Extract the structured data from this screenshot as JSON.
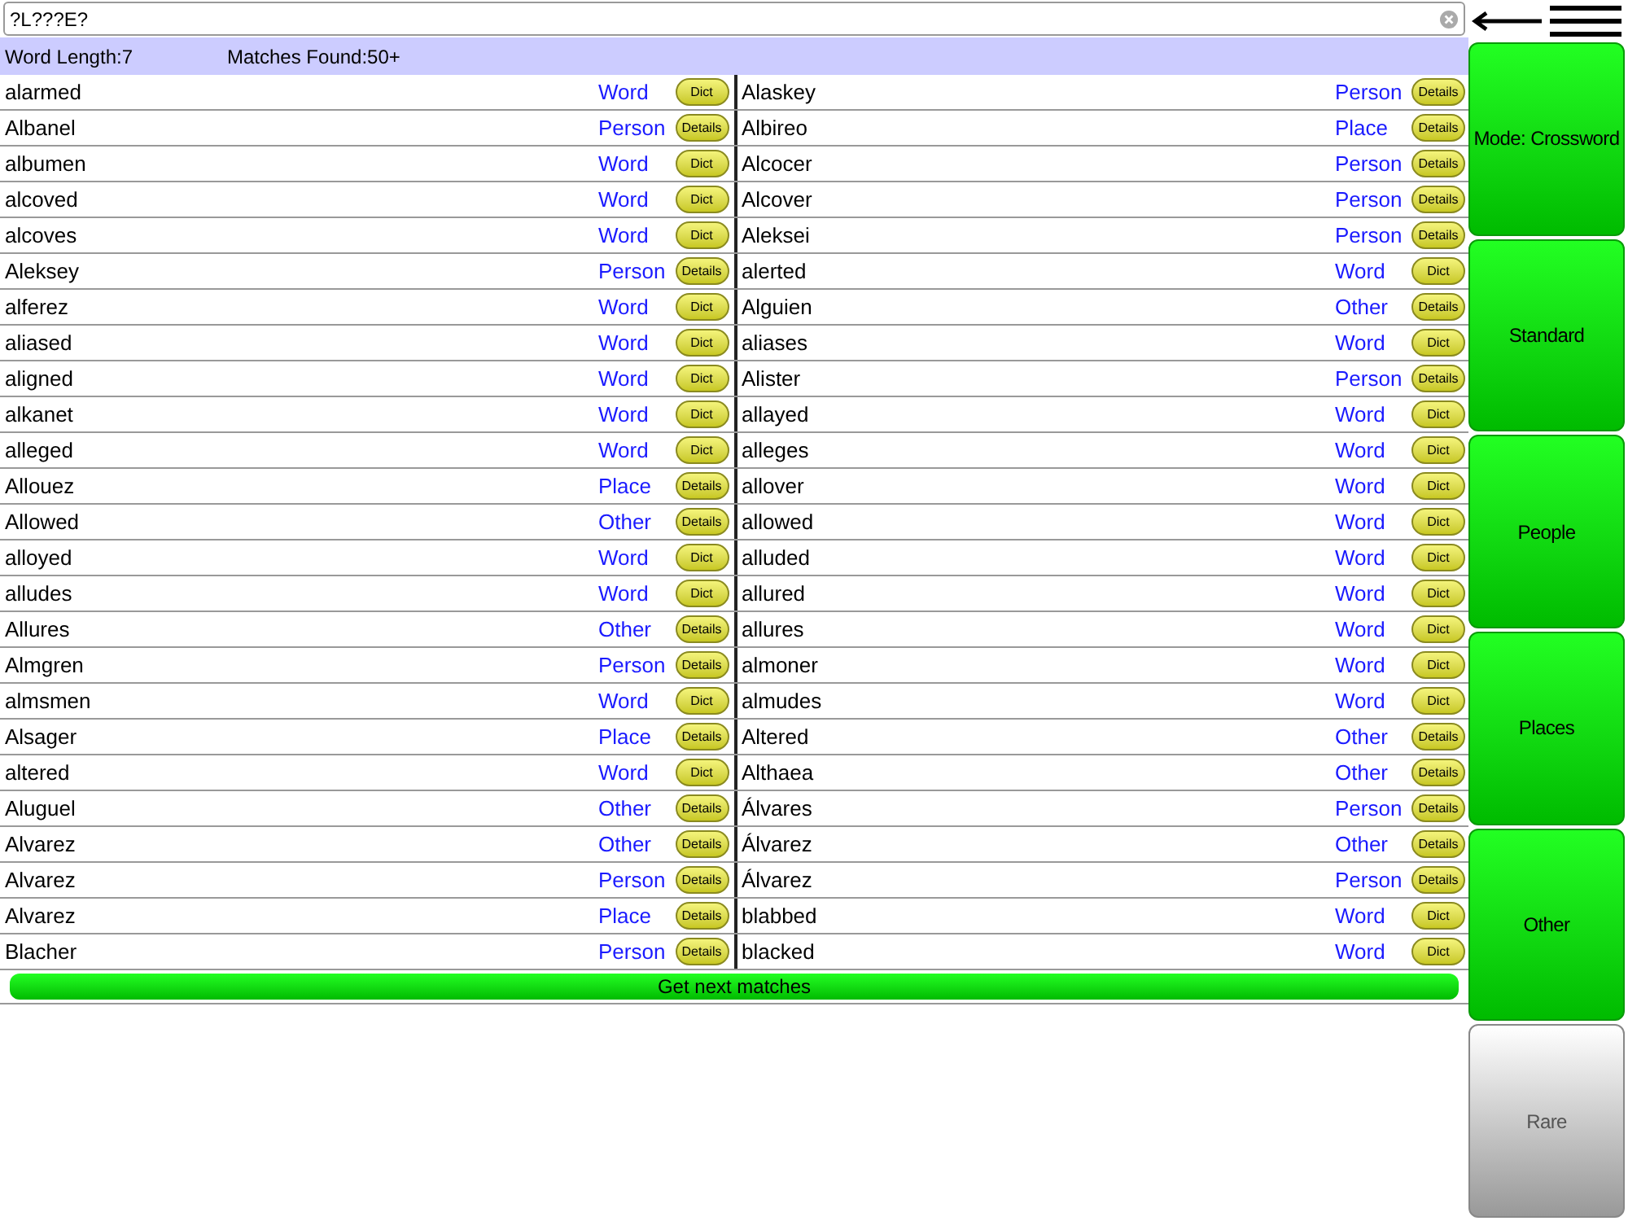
{
  "search": {
    "value": "?L???E?"
  },
  "info": {
    "word_length": "Word Length:7",
    "matches": "Matches Found:50+"
  },
  "rows": [
    {
      "left": {
        "word": "alarmed",
        "type": "Word",
        "button": "Dict"
      },
      "right": {
        "word": "Alaskey",
        "type": "Person",
        "button": "Details"
      }
    },
    {
      "left": {
        "word": "Albanel",
        "type": "Person",
        "button": "Details"
      },
      "right": {
        "word": "Albireo",
        "type": "Place",
        "button": "Details"
      }
    },
    {
      "left": {
        "word": "albumen",
        "type": "Word",
        "button": "Dict"
      },
      "right": {
        "word": "Alcocer",
        "type": "Person",
        "button": "Details"
      }
    },
    {
      "left": {
        "word": "alcoved",
        "type": "Word",
        "button": "Dict"
      },
      "right": {
        "word": "Alcover",
        "type": "Person",
        "button": "Details"
      }
    },
    {
      "left": {
        "word": "alcoves",
        "type": "Word",
        "button": "Dict"
      },
      "right": {
        "word": "Aleksei",
        "type": "Person",
        "button": "Details"
      }
    },
    {
      "left": {
        "word": "Aleksey",
        "type": "Person",
        "button": "Details"
      },
      "right": {
        "word": "alerted",
        "type": "Word",
        "button": "Dict"
      }
    },
    {
      "left": {
        "word": "alferez",
        "type": "Word",
        "button": "Dict"
      },
      "right": {
        "word": "Alguien",
        "type": "Other",
        "button": "Details"
      }
    },
    {
      "left": {
        "word": "aliased",
        "type": "Word",
        "button": "Dict"
      },
      "right": {
        "word": "aliases",
        "type": "Word",
        "button": "Dict"
      }
    },
    {
      "left": {
        "word": "aligned",
        "type": "Word",
        "button": "Dict"
      },
      "right": {
        "word": "Alister",
        "type": "Person",
        "button": "Details"
      }
    },
    {
      "left": {
        "word": "alkanet",
        "type": "Word",
        "button": "Dict"
      },
      "right": {
        "word": "allayed",
        "type": "Word",
        "button": "Dict"
      }
    },
    {
      "left": {
        "word": "alleged",
        "type": "Word",
        "button": "Dict"
      },
      "right": {
        "word": "alleges",
        "type": "Word",
        "button": "Dict"
      }
    },
    {
      "left": {
        "word": "Allouez",
        "type": "Place",
        "button": "Details"
      },
      "right": {
        "word": "allover",
        "type": "Word",
        "button": "Dict"
      }
    },
    {
      "left": {
        "word": "Allowed",
        "type": "Other",
        "button": "Details"
      },
      "right": {
        "word": "allowed",
        "type": "Word",
        "button": "Dict"
      }
    },
    {
      "left": {
        "word": "alloyed",
        "type": "Word",
        "button": "Dict"
      },
      "right": {
        "word": "alluded",
        "type": "Word",
        "button": "Dict"
      }
    },
    {
      "left": {
        "word": "alludes",
        "type": "Word",
        "button": "Dict"
      },
      "right": {
        "word": "allured",
        "type": "Word",
        "button": "Dict"
      }
    },
    {
      "left": {
        "word": "Allures",
        "type": "Other",
        "button": "Details"
      },
      "right": {
        "word": "allures",
        "type": "Word",
        "button": "Dict"
      }
    },
    {
      "left": {
        "word": "Almgren",
        "type": "Person",
        "button": "Details"
      },
      "right": {
        "word": "almoner",
        "type": "Word",
        "button": "Dict"
      }
    },
    {
      "left": {
        "word": "almsmen",
        "type": "Word",
        "button": "Dict"
      },
      "right": {
        "word": "almudes",
        "type": "Word",
        "button": "Dict"
      }
    },
    {
      "left": {
        "word": "Alsager",
        "type": "Place",
        "button": "Details"
      },
      "right": {
        "word": "Altered",
        "type": "Other",
        "button": "Details"
      }
    },
    {
      "left": {
        "word": "altered",
        "type": "Word",
        "button": "Dict"
      },
      "right": {
        "word": "Althaea",
        "type": "Other",
        "button": "Details"
      }
    },
    {
      "left": {
        "word": "Aluguel",
        "type": "Other",
        "button": "Details"
      },
      "right": {
        "word": "Álvares",
        "type": "Person",
        "button": "Details"
      }
    },
    {
      "left": {
        "word": "Alvarez",
        "type": "Other",
        "button": "Details"
      },
      "right": {
        "word": "Álvarez",
        "type": "Other",
        "button": "Details"
      }
    },
    {
      "left": {
        "word": "Alvarez",
        "type": "Person",
        "button": "Details"
      },
      "right": {
        "word": "Álvarez",
        "type": "Person",
        "button": "Details"
      }
    },
    {
      "left": {
        "word": "Alvarez",
        "type": "Place",
        "button": "Details"
      },
      "right": {
        "word": "blabbed",
        "type": "Word",
        "button": "Dict"
      }
    },
    {
      "left": {
        "word": "Blacher",
        "type": "Person",
        "button": "Details"
      },
      "right": {
        "word": "blacked",
        "type": "Word",
        "button": "Dict"
      }
    }
  ],
  "next_button": "Get next matches",
  "modes": [
    {
      "label": "Mode: Crossword",
      "on": true
    },
    {
      "label": "Standard",
      "on": true
    },
    {
      "label": "People",
      "on": true
    },
    {
      "label": "Places",
      "on": true
    },
    {
      "label": "Other",
      "on": true
    },
    {
      "label": "Rare",
      "on": false
    }
  ]
}
